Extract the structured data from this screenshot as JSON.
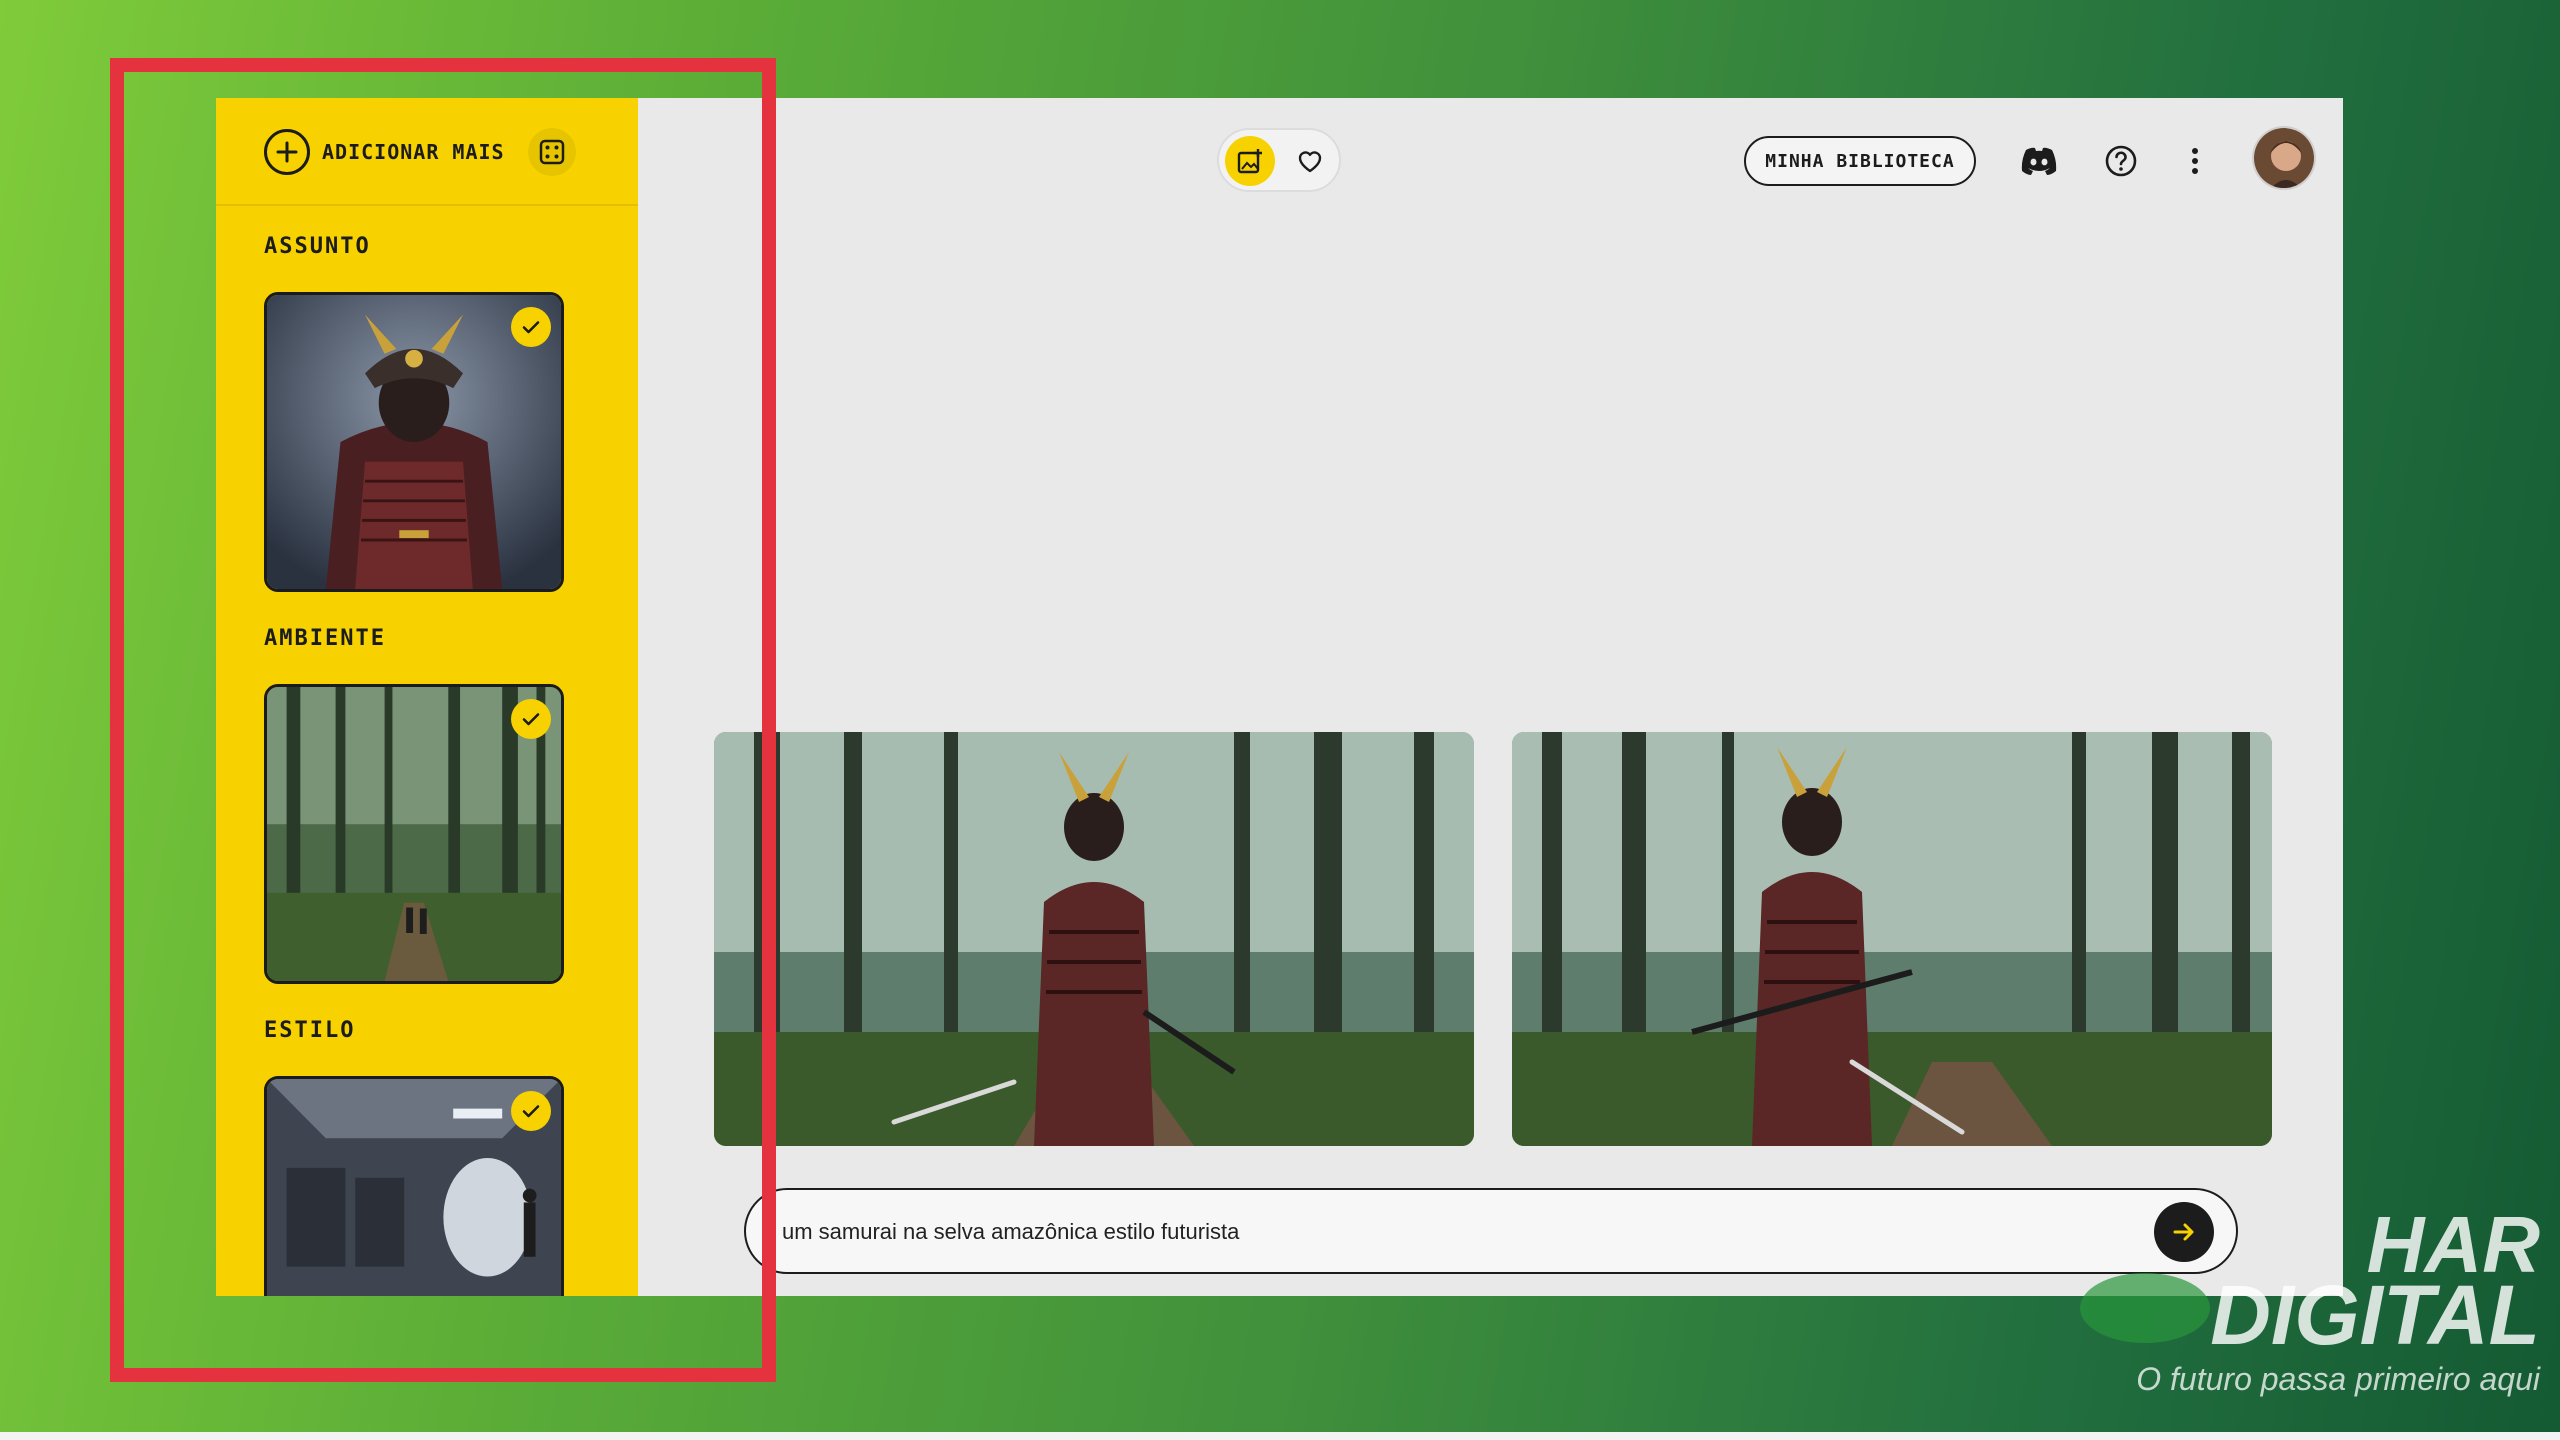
{
  "sidebar": {
    "add_label": "ADICIONAR MAIS",
    "sections": [
      {
        "title": "ASSUNTO"
      },
      {
        "title": "AMBIENTE"
      },
      {
        "title": "ESTILO"
      }
    ]
  },
  "topbar": {
    "library_label": "MINHA BIBLIOTECA"
  },
  "prompt": {
    "value": "um samurai na selva amazônica estilo futurista"
  },
  "watermark": {
    "line1": "HAR",
    "line2": "DIGITAL",
    "tagline": "O futuro passa primeiro aqui"
  },
  "colors": {
    "sidebar_yellow": "#f7d200",
    "app_bg": "#e9e9e9",
    "highlight_red": "#e5323f"
  },
  "icons": [
    "plus-circle-icon",
    "dice-icon",
    "check-icon",
    "image-add-icon",
    "heart-icon",
    "discord-icon",
    "help-icon",
    "more-vert-icon",
    "arrow-right-icon"
  ]
}
